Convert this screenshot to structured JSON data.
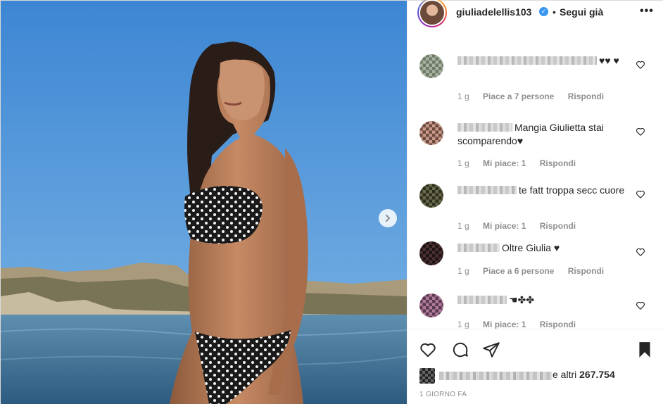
{
  "header": {
    "username": "giuliadelellis103",
    "separator": "•",
    "follow_state": "Segui già",
    "more_icon": "more-horizontal-icon"
  },
  "media": {
    "next_icon": "chevron-right-icon"
  },
  "comments": [
    {
      "text": "♥♥ ♥",
      "time": "1 g",
      "likes": "Piace a 7 persone",
      "reply": "Rispondi"
    },
    {
      "text": "Mangia Giulietta stai scomparendo♥",
      "time": "1 g",
      "likes": "Mi piace: 1",
      "reply": "Rispondi"
    },
    {
      "text": "te fatt troppa secc cuore",
      "time": "1 g",
      "likes": "Mi piace: 1",
      "reply": "Rispondi"
    },
    {
      "text": "Oltre Giulia ♥",
      "time": "1 g",
      "likes": "Piace a 6 persone",
      "reply": "Rispondi"
    },
    {
      "text": "☚✤✤",
      "time": "1 g",
      "likes": "Mi piace: 1",
      "reply": "Rispondi"
    }
  ],
  "actions": {
    "like_icon": "heart-icon",
    "comment_icon": "comment-icon",
    "share_icon": "share-icon",
    "save_icon": "bookmark-icon"
  },
  "likes": {
    "prefix": "e altri ",
    "count": "267.754"
  },
  "timestamp": "1 GIORNO FA",
  "colors": {
    "sky": "#4a8fd0",
    "sea": "#3a6f9a",
    "verified": "#3897f0",
    "muted_text": "#8e8e8e"
  }
}
